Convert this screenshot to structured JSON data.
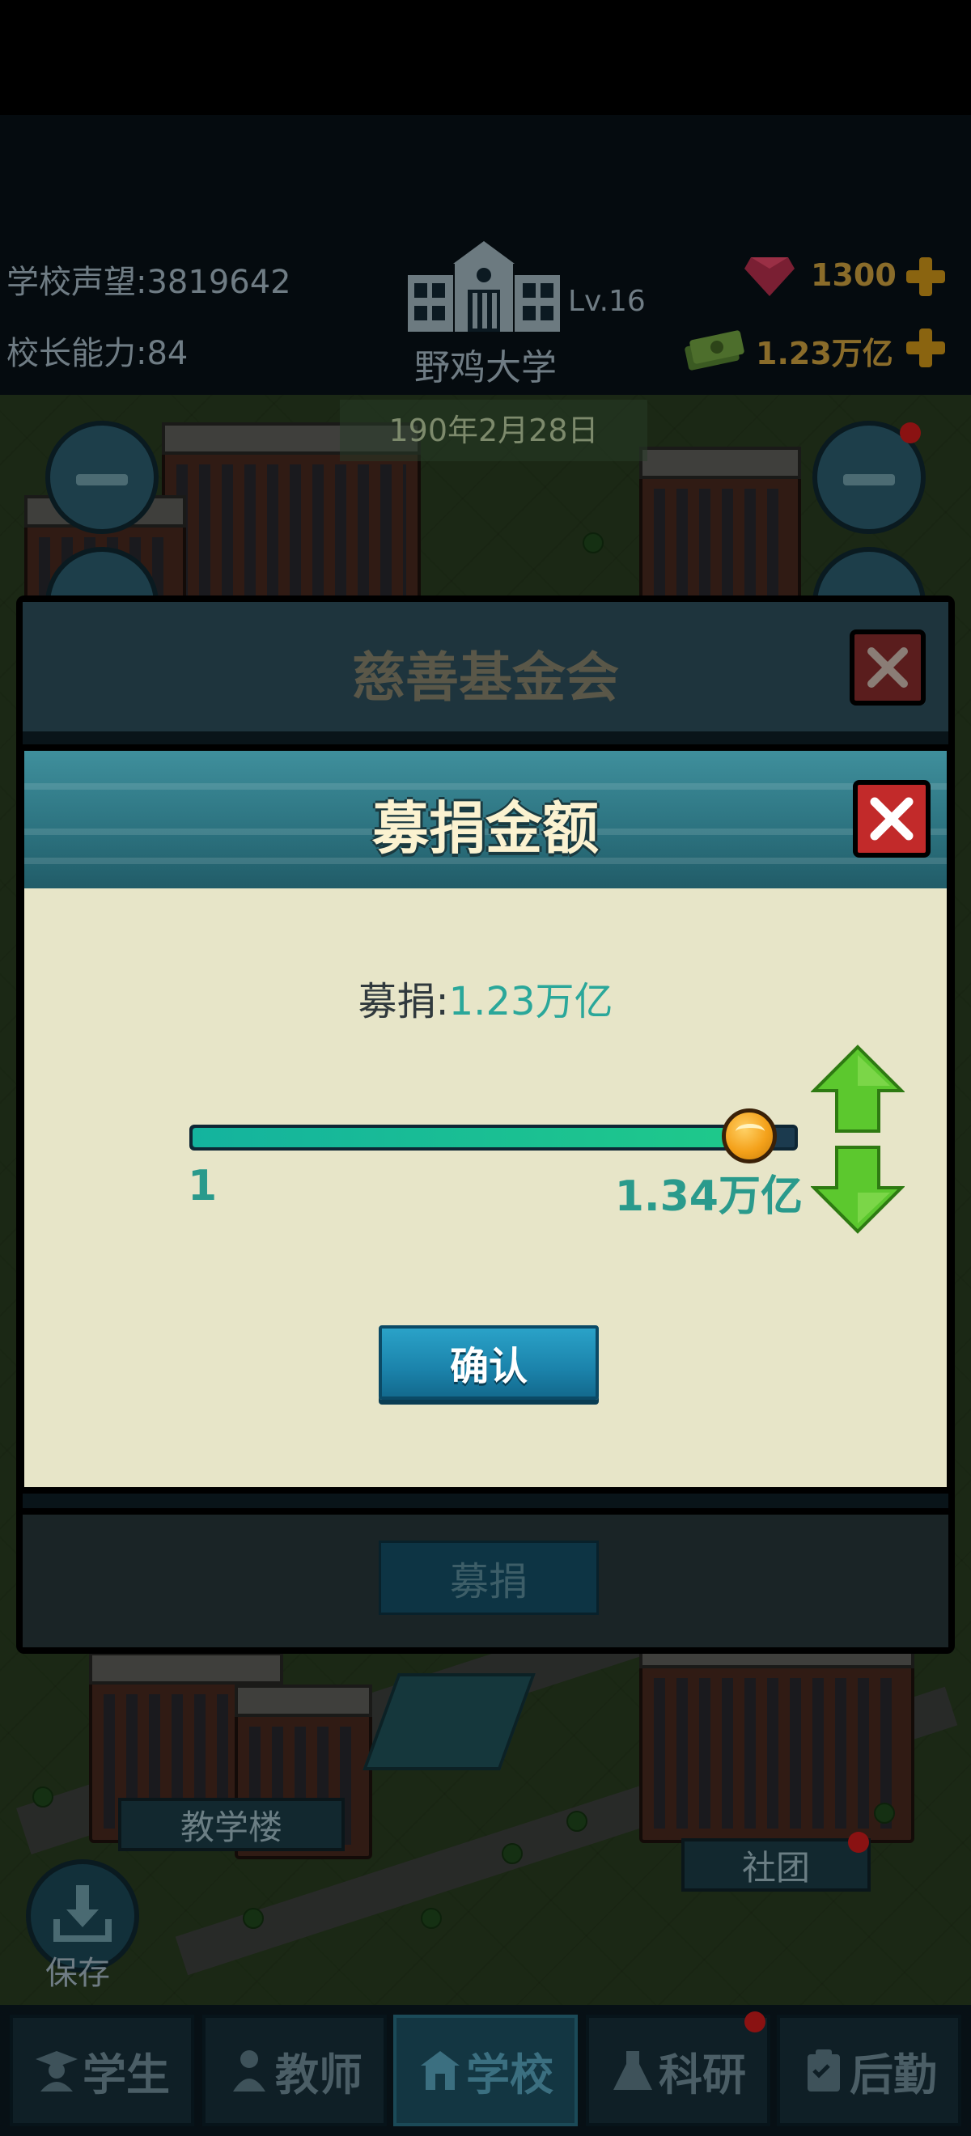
{
  "header": {
    "reputation_label": "学校声望:",
    "reputation_value": "3819642",
    "ability_label": "校长能力:",
    "ability_value": "84",
    "level": "Lv.16",
    "school_name": "野鸡大学",
    "gems": "1300",
    "money": "1.23万亿",
    "date": "190年2月28日"
  },
  "base_dialog": {
    "title": "慈善基金会",
    "donate_button": "募捐"
  },
  "donation_dialog": {
    "title": "募捐金额",
    "amount_label": "募捐:",
    "amount_value": "1.23万亿",
    "slider": {
      "min_label": "1",
      "max_label": "1.34万亿",
      "fraction": 0.92
    },
    "confirm_button": "确认"
  },
  "map": {
    "label_teaching": "教学楼",
    "label_club": "社团",
    "save_label": "保存"
  },
  "nav": {
    "items": [
      "学生",
      "教师",
      "学校",
      "科研",
      "后勤"
    ],
    "active": "学校"
  },
  "colors": {
    "accent_teal": "#2aa79a",
    "gem": "#d8304f",
    "gold": "#d89a1a"
  }
}
